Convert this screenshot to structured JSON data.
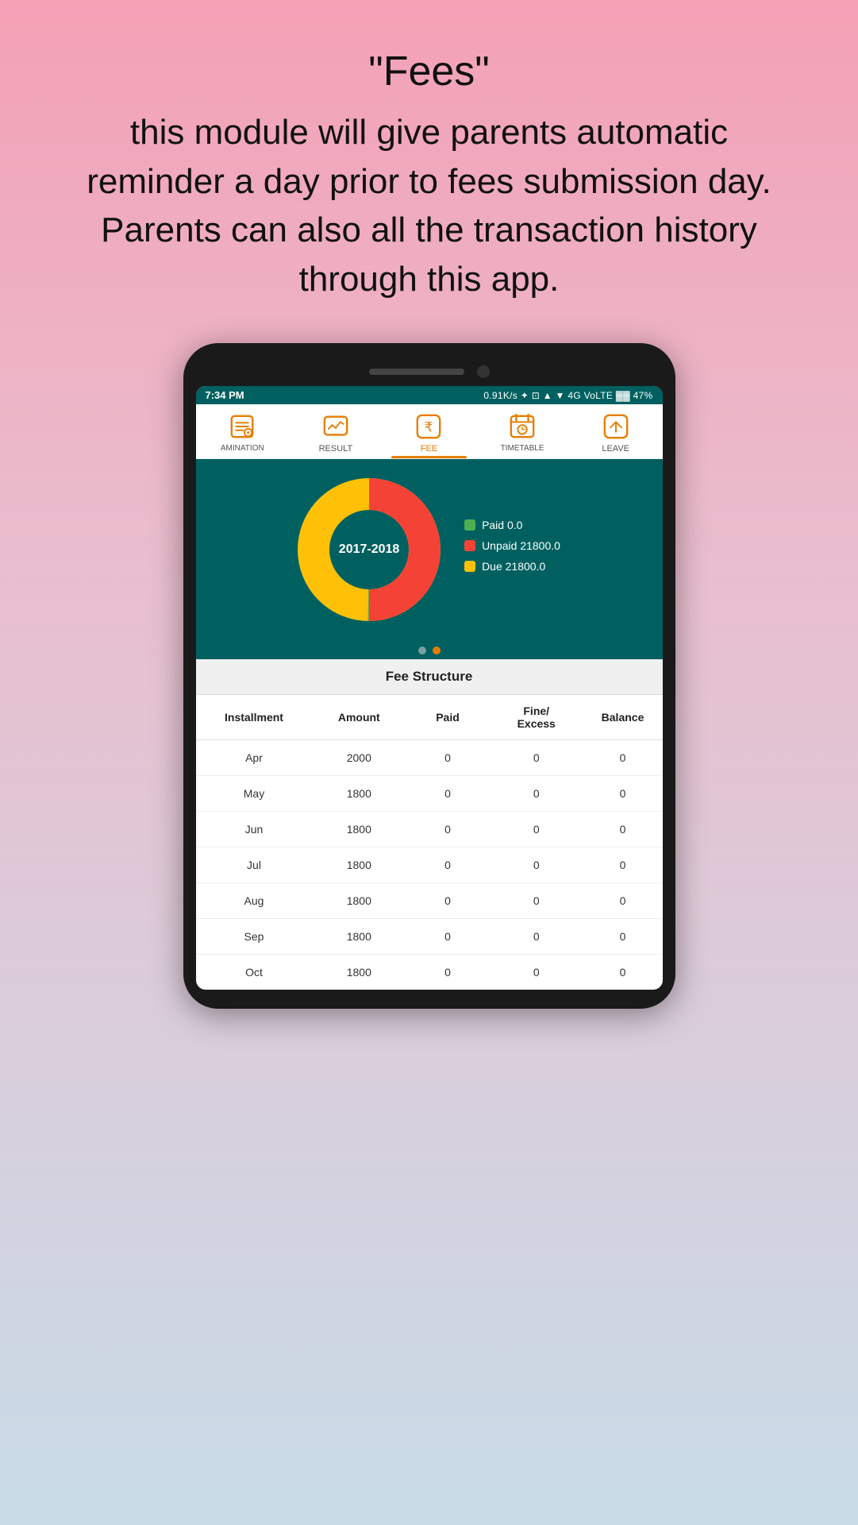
{
  "header": {
    "title": "\"Fees\"",
    "description": "this module will give parents automatic reminder a day prior to fees submission day. Parents can also all the transaction history through this app."
  },
  "statusBar": {
    "time": "7:34 PM",
    "network": "0.91K/s",
    "carrier": "4G VoLTE",
    "battery": "47%"
  },
  "navTabs": [
    {
      "id": "examination",
      "label": "AMINATION",
      "active": false
    },
    {
      "id": "result",
      "label": "RESULT",
      "active": false
    },
    {
      "id": "fee",
      "label": "FEE",
      "active": true
    },
    {
      "id": "timetable",
      "label": "TIMETABLE",
      "active": false
    },
    {
      "id": "leave",
      "label": "LEAVE",
      "active": false
    }
  ],
  "chart": {
    "centerText": "2017-2018",
    "legend": [
      {
        "color": "green",
        "label": "Paid 0.0"
      },
      {
        "color": "red",
        "label": "Unpaid 21800.0"
      },
      {
        "color": "yellow",
        "label": "Due 21800.0"
      }
    ],
    "paid": 0,
    "unpaid": 21800,
    "due": 21800
  },
  "feeStructure": {
    "sectionTitle": "Fee Structure",
    "columns": [
      "Installment",
      "Amount",
      "Paid",
      "Fine/\nExcess",
      "Balance"
    ],
    "rows": [
      {
        "month": "Apr",
        "amount": 2000,
        "paid": 0,
        "fine": 0,
        "balance": 0
      },
      {
        "month": "May",
        "amount": 1800,
        "paid": 0,
        "fine": 0,
        "balance": 0
      },
      {
        "month": "Jun",
        "amount": 1800,
        "paid": 0,
        "fine": 0,
        "balance": 0
      },
      {
        "month": "Jul",
        "amount": 1800,
        "paid": 0,
        "fine": 0,
        "balance": 0
      },
      {
        "month": "Aug",
        "amount": 1800,
        "paid": 0,
        "fine": 0,
        "balance": 0
      },
      {
        "month": "Sep",
        "amount": 1800,
        "paid": 0,
        "fine": 0,
        "balance": 0
      },
      {
        "month": "Oct",
        "amount": 1800,
        "paid": 0,
        "fine": 0,
        "balance": 0
      }
    ]
  }
}
